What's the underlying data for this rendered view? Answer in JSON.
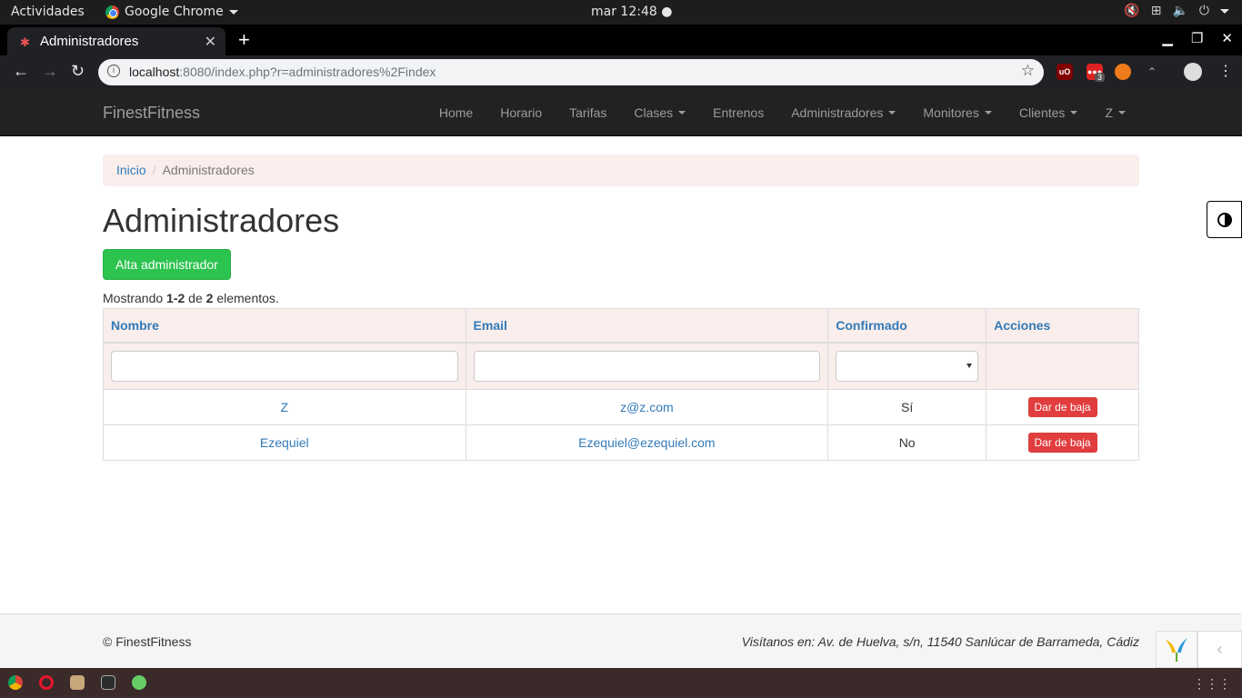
{
  "os": {
    "activities": "Actividades",
    "app_name": "Google Chrome",
    "clock": "mar 12:48 ●"
  },
  "browser": {
    "tab_title": "Administradores",
    "url_host": "localhost",
    "url_rest": ":8080/index.php?r=administradores%2Findex",
    "ext_badge": "3"
  },
  "site": {
    "brand": "FinestFitness",
    "menu": [
      {
        "label": "Home",
        "dropdown": false
      },
      {
        "label": "Horario",
        "dropdown": false
      },
      {
        "label": "Tarifas",
        "dropdown": false
      },
      {
        "label": "Clases",
        "dropdown": true
      },
      {
        "label": "Entrenos",
        "dropdown": false
      },
      {
        "label": "Administradores",
        "dropdown": true
      },
      {
        "label": "Monitores",
        "dropdown": true
      },
      {
        "label": "Clientes",
        "dropdown": true
      },
      {
        "label": "Z",
        "dropdown": true
      }
    ]
  },
  "breadcrumb": {
    "home": "Inicio",
    "current": "Administradores"
  },
  "page": {
    "title": "Administradores",
    "add_button": "Alta administrador",
    "summary_prefix": "Mostrando ",
    "summary_range": "1-2",
    "summary_mid": " de ",
    "summary_total": "2",
    "summary_suffix": " elementos."
  },
  "table": {
    "headers": [
      "Nombre",
      "Email",
      "Confirmado",
      "Acciones"
    ],
    "filters": {
      "nombre": "",
      "email": "",
      "confirmado": ""
    },
    "rows": [
      {
        "nombre": "Z",
        "email": "z@z.com",
        "confirmado": "Sí",
        "action": "Dar de baja"
      },
      {
        "nombre": "Ezequiel",
        "email": "Ezequiel@ezequiel.com",
        "confirmado": "No",
        "action": "Dar de baja"
      }
    ]
  },
  "footer": {
    "copyright": "© FinestFitness",
    "address": "Visítanos en: Av. de Huelva, s/n, 11540 Sanlúcar de Barrameda, Cádiz"
  },
  "colors": {
    "success": "#2dc34f",
    "danger": "#e13d3f",
    "link": "#337ab7",
    "navbar": "#222222"
  }
}
